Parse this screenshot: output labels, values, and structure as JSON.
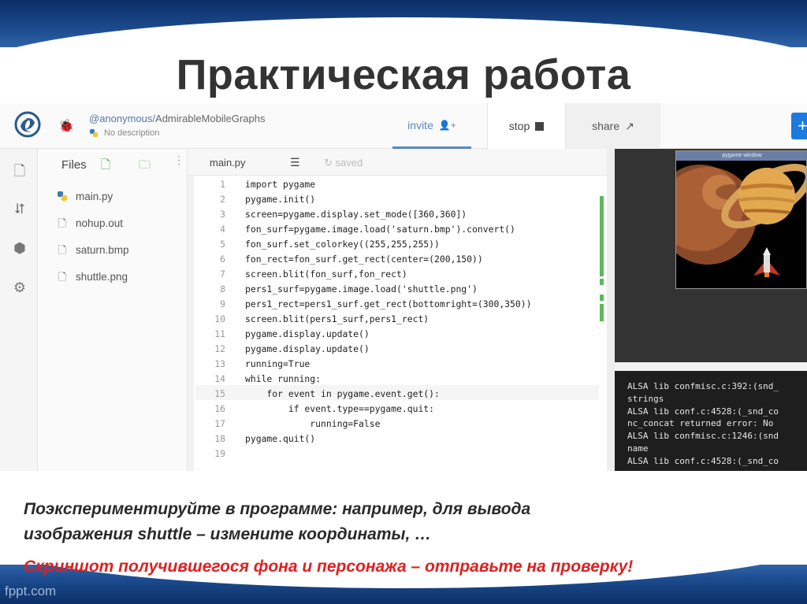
{
  "slide": {
    "title": "Практическая работа",
    "instruction_line1": "Поэкспериментируйте в программе: например, для вывода",
    "instruction_line2": "изображения shuttle – измените координаты, …",
    "task": "Скриншот получившегося фона и персонажа – отправьте на проверку!",
    "watermark": "fppt.com"
  },
  "repl": {
    "user": "@anonymous/",
    "repl_name": "AdmirableMobileGraphs",
    "description": "No description",
    "buttons": {
      "invite": "invite",
      "stop": "stop",
      "share": "share",
      "plus": "+"
    },
    "files_header": "Files",
    "files": [
      {
        "name": "main.py",
        "icon": "python-icon"
      },
      {
        "name": "nohup.out",
        "icon": "file-icon"
      },
      {
        "name": "saturn.bmp",
        "icon": "file-icon"
      },
      {
        "name": "shuttle.png",
        "icon": "file-icon"
      }
    ],
    "editor_tab": "main.py",
    "saved_status": "saved",
    "code": [
      {
        "n": "1",
        "t": "import pygame"
      },
      {
        "n": "2",
        "t": "pygame.init()"
      },
      {
        "n": "3",
        "t": "screen=pygame.display.set_mode([360,360])"
      },
      {
        "n": "4",
        "t": "fon_surf=pygame.image.load('saturn.bmp').convert()"
      },
      {
        "n": "5",
        "t": "fon_surf.set_colorkey((255,255,255))"
      },
      {
        "n": "6",
        "t": "fon_rect=fon_surf.get_rect(center=(200,150))"
      },
      {
        "n": "7",
        "t": "screen.blit(fon_surf,fon_rect)"
      },
      {
        "n": "8",
        "t": "pers1_surf=pygame.image.load('shuttle.png')"
      },
      {
        "n": "9",
        "t": "pers1_rect=pers1_surf.get_rect(bottomright=(300,350))"
      },
      {
        "n": "10",
        "t": "screen.blit(pers1_surf,pers1_rect)"
      },
      {
        "n": "11",
        "t": "pygame.display.update()"
      },
      {
        "n": "12",
        "t": "pygame.display.update()"
      },
      {
        "n": "13",
        "t": "running=True"
      },
      {
        "n": "14",
        "t": "while running:"
      },
      {
        "n": "15",
        "t": "    for event in pygame.event.get():"
      },
      {
        "n": "16",
        "t": "        if event.type==pygame.quit:"
      },
      {
        "n": "17",
        "t": "            running=False"
      },
      {
        "n": "18",
        "t": "pygame.quit()"
      },
      {
        "n": "19",
        "t": ""
      }
    ],
    "pygame_window_title": "pygame window",
    "console": [
      "ALSA lib confmisc.c:392:(snd_",
      "strings",
      "ALSA lib conf.c:4528:(_snd_co",
      "nc_concat returned error: No",
      "ALSA lib confmisc.c:1246:(snd",
      "name",
      "ALSA lib conf.c:4528:(_snd_co"
    ]
  },
  "colors": {
    "accent": "#5a86c4",
    "brand_blue": "#1b4a8d",
    "task_red": "#e02020"
  }
}
